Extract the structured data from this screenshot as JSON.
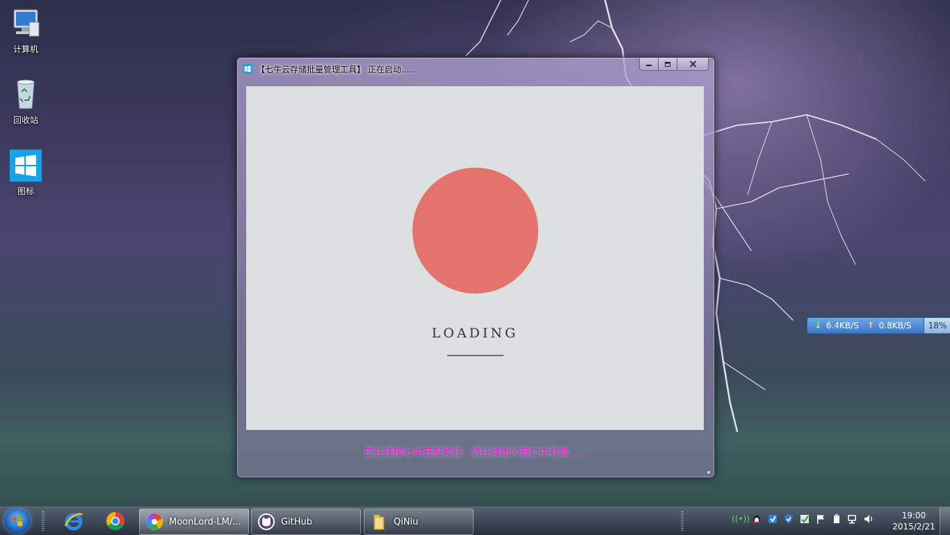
{
  "desktop": {
    "icons": [
      {
        "label": "计算机",
        "icon": "computer-icon"
      },
      {
        "label": "回收站",
        "icon": "recycle-bin-icon"
      },
      {
        "label": "图标",
        "icon": "windows-logo-icon"
      }
    ]
  },
  "window": {
    "title": "【七牛云存储批量管理工具】  正在启动......",
    "loading_text": "LOADING",
    "status_text": "正在连接七牛云服务器，请在弹出的窗口中登录......",
    "colors": {
      "circle": "#e4736c",
      "panel": "#dde0e1",
      "status": "#e31ad6"
    }
  },
  "network_widget": {
    "download": "6.4KB/S",
    "upload": "0.8KB/S",
    "percent": "18%"
  },
  "taskbar": {
    "pinned": [
      {
        "icon": "internet-explorer-icon"
      },
      {
        "icon": "chrome-icon"
      }
    ],
    "tasks": [
      {
        "label": "MoonLord-LM/...",
        "icon": "picasa-icon"
      },
      {
        "label": "GitHub",
        "icon": "github-icon"
      },
      {
        "label": "QiNiu",
        "icon": "folder-icon"
      }
    ],
    "clock": {
      "time": "19:00",
      "date": "2015/2/21"
    }
  }
}
